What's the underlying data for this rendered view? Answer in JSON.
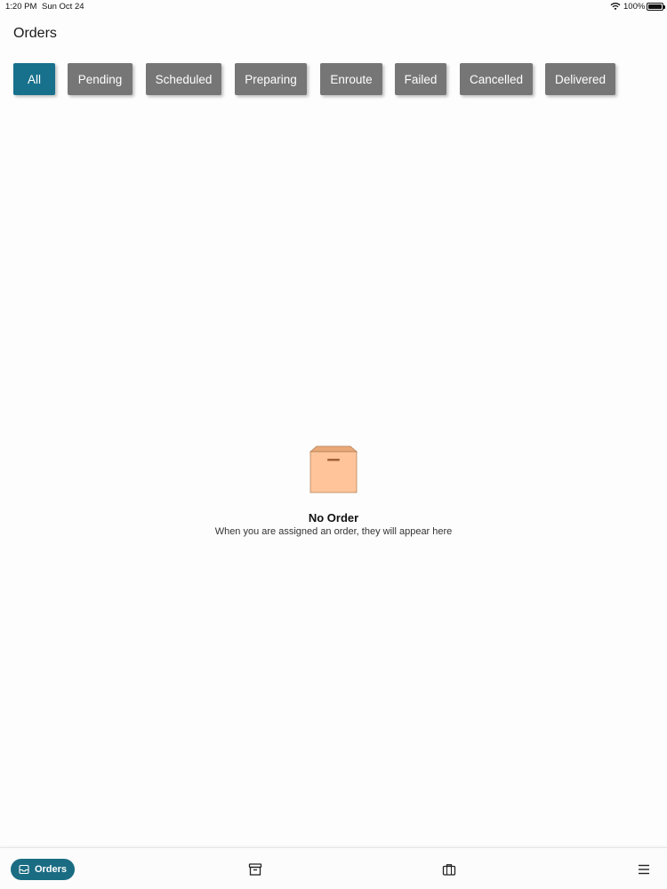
{
  "status_bar": {
    "time": "1:20 PM",
    "date": "Sun Oct 24",
    "battery_percent": "100%",
    "battery_level": 1.0,
    "wifi_icon": "wifi-icon",
    "battery_icon": "battery-icon"
  },
  "header": {
    "title": "Orders"
  },
  "filters": {
    "active": "All",
    "items": [
      "All",
      "Pending",
      "Scheduled",
      "Preparing",
      "Enroute",
      "Failed",
      "Cancelled",
      "Delivered"
    ]
  },
  "empty_state": {
    "icon": "box-icon",
    "title": "No Order",
    "message": "When you are assigned an order, they will appear here"
  },
  "tabbar": {
    "orders_label": "Orders",
    "orders_icon": "inbox-icon",
    "archive_icon": "archive-icon",
    "briefcase_icon": "briefcase-icon",
    "menu_icon": "menu-icon"
  },
  "colors": {
    "accent": "#17718c",
    "filter_inactive": "#767676",
    "box_fill": "#ffc49a",
    "box_stroke": "#b5835c"
  }
}
